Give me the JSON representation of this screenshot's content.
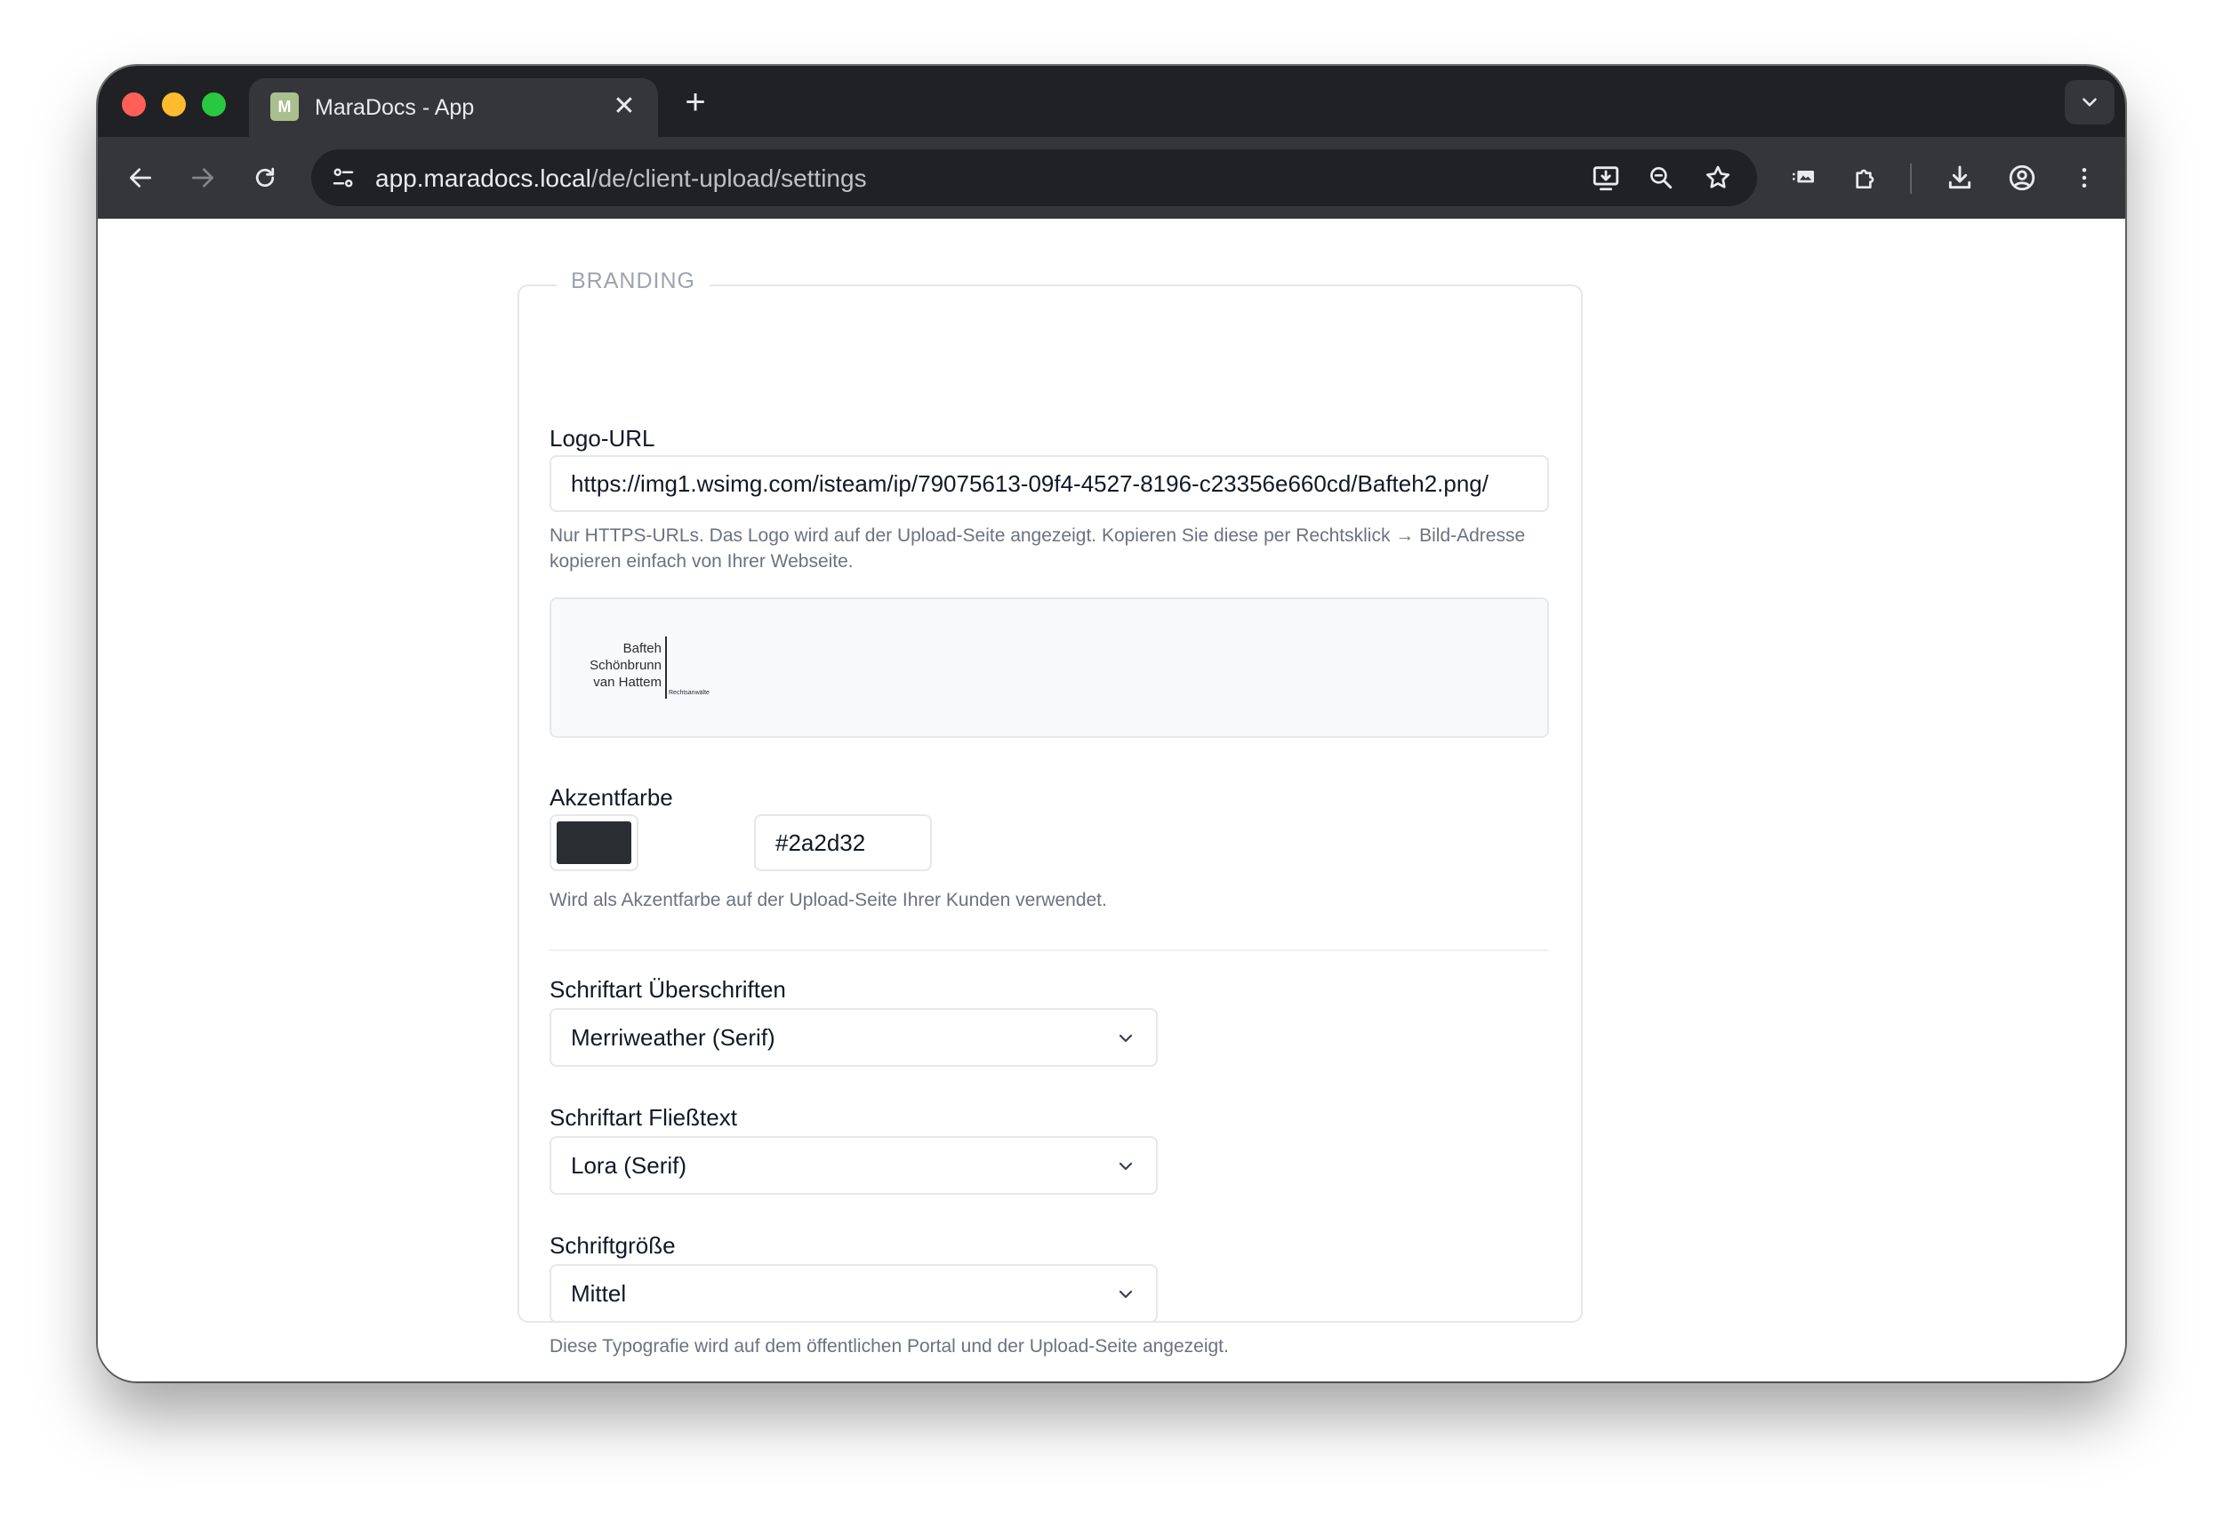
{
  "browser": {
    "tab_title": "MaraDocs - App",
    "tab_favicon": "M",
    "tab_close": "✕",
    "new_tab": "+",
    "url_host": "app.maradocs.local",
    "url_path": "/de/client-upload/settings"
  },
  "section": {
    "legend": "BRANDING"
  },
  "logo": {
    "label": "Logo-URL",
    "value": "https://img1.wsimg.com/isteam/ip/79075613-09f4-4527-8196-c23356e660cd/Bafteh2.png/",
    "hint": "Nur HTTPS-URLs. Das Logo wird auf der Upload-Seite angezeigt. Kopieren Sie diese per Rechtsklick → Bild-Adresse kopieren einfach von Ihrer Webseite.",
    "preview_line1": "Bafteh",
    "preview_line2": "Schönbrunn",
    "preview_line3": "van Hattem",
    "preview_sub": "Rechtsanwälte"
  },
  "accent": {
    "label": "Akzentfarbe",
    "value": "#2a2d32",
    "color": "#2a2d32",
    "hint": "Wird als Akzentfarbe auf der Upload-Seite Ihrer Kunden verwendet."
  },
  "font_headings": {
    "label": "Schriftart Überschriften",
    "value": "Merriweather (Serif)"
  },
  "font_body": {
    "label": "Schriftart Fließtext",
    "value": "Lora (Serif)"
  },
  "font_size": {
    "label": "Schriftgröße",
    "value": "Mittel",
    "hint": "Diese Typografie wird auf dem öffentlichen Portal und der Upload-Seite angezeigt."
  },
  "icons": {
    "back": "arrow-left-icon",
    "forward": "arrow-right-icon",
    "reload": "reload-icon",
    "site_settings": "tune-icon",
    "install": "install-app-icon",
    "zoom": "zoom-out-icon",
    "bookmark": "star-icon",
    "media": "media-icon",
    "extensions": "puzzle-icon",
    "downloads": "download-icon",
    "profile": "profile-icon",
    "menu": "more-vert-icon",
    "tab_search": "chevron-down-icon"
  }
}
